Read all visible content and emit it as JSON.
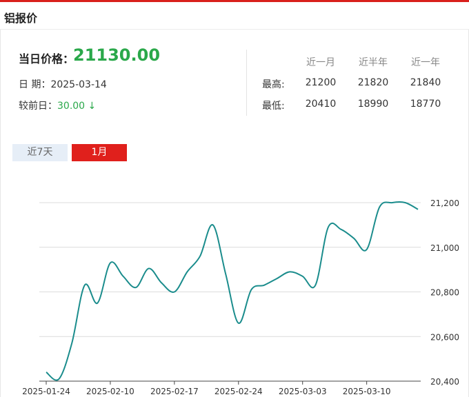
{
  "header": {
    "title": "铝报价"
  },
  "summary": {
    "price_label": "当日价格：",
    "price": "21130.00",
    "date_label": "日 期：",
    "date": "2025-03-14",
    "change_label": "较前日：",
    "change": "30.00",
    "change_icon": "arrow-down-icon",
    "change_arrow": "↓",
    "change_color": "#2aa84a"
  },
  "stats": {
    "headers": [
      "近一月",
      "近半年",
      "近一年"
    ],
    "rows": [
      {
        "label": "最高:",
        "values": [
          "21200",
          "21820",
          "21840"
        ]
      },
      {
        "label": "最低:",
        "values": [
          "20410",
          "18990",
          "18770"
        ]
      }
    ]
  },
  "tabs": [
    {
      "label": "近7天",
      "active": false
    },
    {
      "label": "1月",
      "active": true
    }
  ],
  "colors": {
    "accent": "#e0201c",
    "line": "#1a8c8c",
    "price_green": "#2aa84a"
  },
  "chart_data": {
    "type": "line",
    "x": [
      "2025-01-24",
      "2025-01-27",
      "2025-02-05",
      "2025-02-06",
      "2025-02-07",
      "2025-02-10",
      "2025-02-11",
      "2025-02-12",
      "2025-02-13",
      "2025-02-14",
      "2025-02-17",
      "2025-02-18",
      "2025-02-19",
      "2025-02-20",
      "2025-02-21",
      "2025-02-24",
      "2025-02-25",
      "2025-02-26",
      "2025-02-27",
      "2025-02-28",
      "2025-03-03",
      "2025-03-04",
      "2025-03-05",
      "2025-03-06",
      "2025-03-07",
      "2025-03-10",
      "2025-03-11",
      "2025-03-12",
      "2025-03-13",
      "2025-03-14"
    ],
    "values": [
      20440,
      20410,
      20570,
      20830,
      20750,
      20930,
      20870,
      20820,
      20905,
      20840,
      20800,
      20890,
      20960,
      21100,
      20880,
      20660,
      20810,
      20830,
      20860,
      20890,
      20870,
      20830,
      21090,
      21080,
      21040,
      20990,
      21180,
      21200,
      21200,
      21170
    ],
    "xticks": [
      "2025-01-24",
      "2025-02-10",
      "2025-02-17",
      "2025-02-24",
      "2025-03-03",
      "2025-03-10"
    ],
    "yticks": [
      "20,400",
      "20,600",
      "20,800",
      "21,000",
      "21,200"
    ],
    "ylim": [
      20400,
      21200
    ],
    "title": "",
    "xlabel": "",
    "ylabel": "",
    "grid": "horizontal",
    "y_axis_side": "right"
  }
}
